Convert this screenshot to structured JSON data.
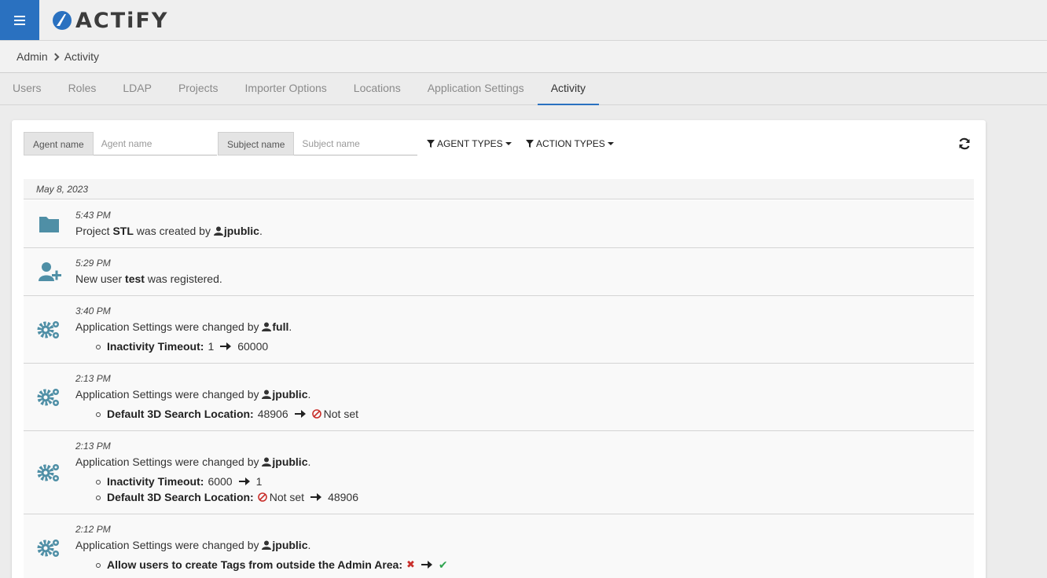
{
  "app": {
    "logo_text": "ACTiFY"
  },
  "breadcrumb": {
    "root": "Admin",
    "current": "Activity"
  },
  "tabs": [
    {
      "label": "Users"
    },
    {
      "label": "Roles"
    },
    {
      "label": "LDAP"
    },
    {
      "label": "Projects"
    },
    {
      "label": "Importer Options"
    },
    {
      "label": "Locations"
    },
    {
      "label": "Application Settings"
    },
    {
      "label": "Activity",
      "active": true
    }
  ],
  "filters": {
    "agent_label": "Agent name",
    "agent_placeholder": "Agent name",
    "subject_label": "Subject name",
    "subject_placeholder": "Subject name",
    "agent_types": "AGENT TYPES",
    "action_types": "ACTION TYPES"
  },
  "date_group": "May 8, 2023",
  "entries": [
    {
      "icon": "folder-icon",
      "time": "5:43 PM",
      "pre": "Project ",
      "subject": "STL",
      "mid": " was created by ",
      "user": "jpublic",
      "post": "."
    },
    {
      "icon": "user-plus-icon",
      "time": "5:29 PM",
      "pre": "New user ",
      "subject": "test",
      "post": " was registered."
    },
    {
      "icon": "gears-icon",
      "time": "3:40 PM",
      "pre": "Application Settings were changed by ",
      "user": "full",
      "post": ".",
      "changes": [
        {
          "name": "Inactivity Timeout:",
          "from": "1",
          "to": "60000"
        }
      ]
    },
    {
      "icon": "gears-icon",
      "time": "2:13 PM",
      "pre": "Application Settings were changed by ",
      "user": "jpublic",
      "post": ".",
      "changes": [
        {
          "name": "Default 3D Search Location:",
          "from": "48906",
          "to": "Not set"
        }
      ]
    },
    {
      "icon": "gears-icon",
      "time": "2:13 PM",
      "pre": "Application Settings were changed by ",
      "user": "jpublic",
      "post": ".",
      "changes": [
        {
          "name": "Inactivity Timeout:",
          "from": "6000",
          "to": "1"
        },
        {
          "name": "Default 3D Search Location:",
          "from": "Not set",
          "to": "48906"
        }
      ]
    },
    {
      "icon": "gears-icon",
      "time": "2:12 PM",
      "pre": "Application Settings were changed by ",
      "user": "jpublic",
      "post": ".",
      "changes": [
        {
          "name": "Allow users to create Tags from outside the Admin Area:",
          "from": "✖",
          "to": "✔"
        }
      ]
    }
  ],
  "colors": {
    "accent": "#2a71c0",
    "icon": "#4f8fa6",
    "danger": "#c9302c",
    "success": "#2ea44f"
  }
}
